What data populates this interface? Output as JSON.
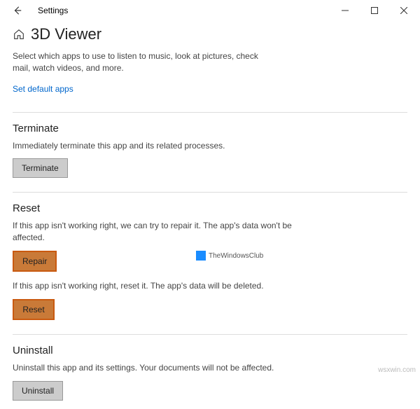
{
  "window": {
    "title": "Settings"
  },
  "page": {
    "title": "3D Viewer",
    "subtitle": "Select which apps to use to listen to music, look at pictures, check mail, watch videos, and more.",
    "link": "Set default apps"
  },
  "sections": {
    "terminate": {
      "heading": "Terminate",
      "desc": "Immediately terminate this app and its related processes.",
      "button": "Terminate"
    },
    "reset": {
      "heading": "Reset",
      "desc1": "If this app isn't working right, we can try to repair it. The app's data won't be affected.",
      "button1": "Repair",
      "desc2": "If this app isn't working right, reset it. The app's data will be deleted.",
      "button2": "Reset"
    },
    "uninstall": {
      "heading": "Uninstall",
      "desc": "Uninstall this app and its settings. Your documents will not be affected.",
      "button": "Uninstall"
    }
  },
  "watermark_center": "TheWindowsClub",
  "watermark_bottom": "wsxwin.com"
}
